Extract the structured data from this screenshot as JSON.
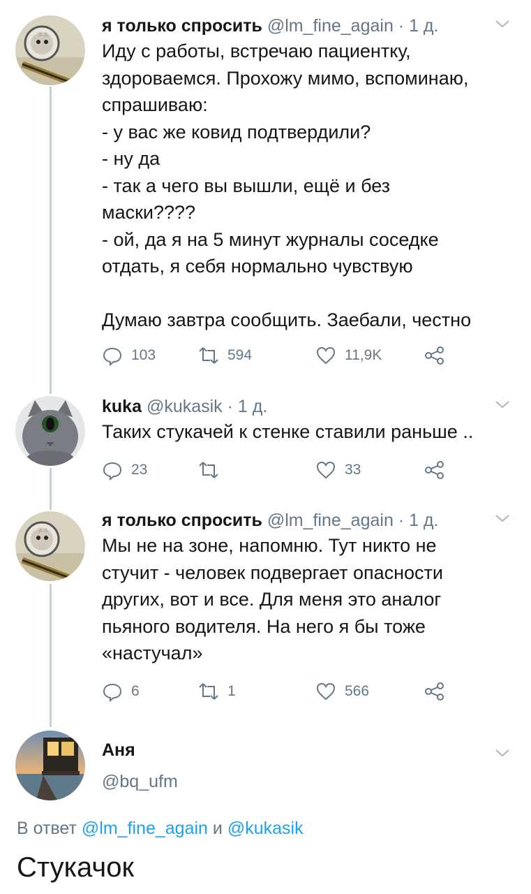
{
  "thread": [
    {
      "display_name": "я только спросить",
      "handle": "@lm_fine_again",
      "time": "· 1 д.",
      "lines": [
        "Иду с работы, встречаю пациентку,",
        "здороваемся. Прохожу мимо, вспоминаю,",
        "спрашиваю:",
        "- у вас же ковид подтвердили?",
        "- ну да",
        "- так а чего вы вышли, ещё и без",
        "маски????",
        "- ой, да я на 5 минут журналы соседке",
        "отдать, я себя нормально чувствую",
        "",
        "Думаю завтра сообщить. Заебали, честно"
      ],
      "replies": "103",
      "retweets": "594",
      "likes": "11,9K"
    },
    {
      "display_name": "kuka",
      "handle": "@kukasik",
      "time": "· 1 д.",
      "lines": [
        "Таких стукачей к стенке ставили раньше .."
      ],
      "replies": "23",
      "retweets": "",
      "likes": "33"
    },
    {
      "display_name": "я только спросить",
      "handle": "@lm_fine_again",
      "time": "· 1 д.",
      "lines": [
        "Мы не на зоне, напомню. Тут никто не",
        "стучит - человек подвергает опасности",
        "других, вот и все. Для меня это аналог",
        "пьяного водителя. На него я бы тоже",
        "«настучал»"
      ],
      "replies": "6",
      "retweets": "1",
      "likes": "566"
    }
  ],
  "focused": {
    "display_name": "Аня",
    "handle": "@bq_ufm",
    "reply_prefix": "В ответ",
    "reply_to_1": "@lm_fine_again",
    "reply_and": "и",
    "reply_to_2": "@kukasik",
    "text": "Стукачок"
  },
  "colors": {
    "accent": "#1da1f2",
    "secondary_text": "#657786",
    "thread_line": "#c4cfd6"
  },
  "icons": [
    "reply-icon",
    "retweet-icon",
    "like-icon",
    "share-icon",
    "chevron-down-icon"
  ]
}
